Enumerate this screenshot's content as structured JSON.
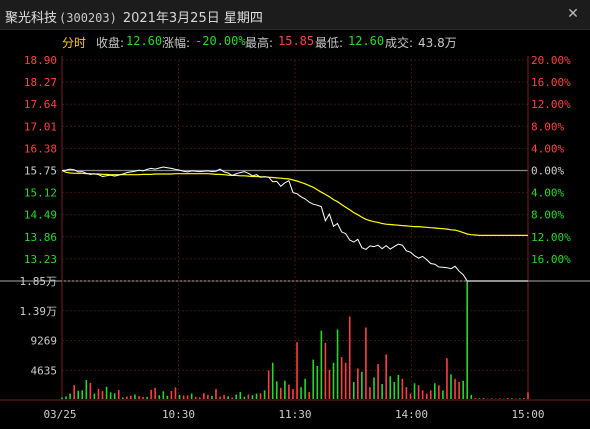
{
  "window": {
    "stock_name": "聚光科技",
    "stock_code": "(300203)",
    "date": "2021年3月25日",
    "weekday": "星期四",
    "close_icon": "close-icon"
  },
  "info_bar": {
    "tab_label": "分时",
    "close_label": "收盘:",
    "close_value": "12.60",
    "change_label": "涨幅:",
    "change_value": "-20.00%",
    "high_label": "最高:",
    "high_value": "15.85",
    "low_label": "最低:",
    "low_value": "12.60",
    "volume_label": "成交:",
    "volume_value": "43.8万"
  },
  "colors": {
    "background": "#000000",
    "price_line": "#ffffff",
    "avg_line": "#ffff00",
    "up": "#ff4040",
    "down": "#26d926",
    "grid": "#4a1a1a"
  },
  "chart_data": {
    "type": "line",
    "prev_close": 15.75,
    "y_ticks": [
      "18.90",
      "18.27",
      "17.64",
      "17.01",
      "16.38",
      "15.75",
      "15.12",
      "14.49",
      "13.86",
      "13.23"
    ],
    "pct_ticks_up": [
      "20.00%",
      "16.00%",
      "12.00%",
      "8.00%",
      "4.00%",
      "0.00%"
    ],
    "pct_ticks_down": [
      "4.00%",
      "8.00%",
      "12.00%",
      "16.00%"
    ],
    "ylim": [
      12.6,
      18.9
    ],
    "x_ticks": [
      "03/25",
      "10:30",
      "11:30",
      "14:00",
      "15:00"
    ],
    "price": [
      15.75,
      15.76,
      15.79,
      15.77,
      15.71,
      15.72,
      15.67,
      15.64,
      15.66,
      15.63,
      15.58,
      15.6,
      15.62,
      15.59,
      15.62,
      15.65,
      15.69,
      15.71,
      15.73,
      15.76,
      15.74,
      15.78,
      15.81,
      15.79,
      15.82,
      15.85,
      15.83,
      15.81,
      15.78,
      15.76,
      15.73,
      15.71,
      15.74,
      15.73,
      15.72,
      15.73,
      15.74,
      15.72,
      15.73,
      15.79,
      15.71,
      15.68,
      15.61,
      15.66,
      15.69,
      15.72,
      15.67,
      15.6,
      15.63,
      15.56,
      15.57,
      15.56,
      15.43,
      15.44,
      15.3,
      15.4,
      15.46,
      15.12,
      15.09,
      15.0,
      14.94,
      14.85,
      14.79,
      14.76,
      14.72,
      14.32,
      14.51,
      14.16,
      14.24,
      14.0,
      13.95,
      13.77,
      13.71,
      13.79,
      13.55,
      13.5,
      13.6,
      13.58,
      13.62,
      13.52,
      13.61,
      13.51,
      13.58,
      13.65,
      13.62,
      13.46,
      13.42,
      13.32,
      13.25,
      13.3,
      13.21,
      13.1,
      13.08,
      13.0,
      12.99,
      12.98,
      12.95,
      13.02,
      12.88,
      12.78,
      12.6,
      12.6,
      12.6,
      12.6,
      12.6,
      12.6,
      12.6,
      12.6,
      12.6,
      12.6,
      12.6,
      12.6,
      12.6,
      12.6,
      12.6,
      12.6
    ],
    "avg_price": [
      15.75,
      15.7,
      15.68,
      15.67,
      15.67,
      15.67,
      15.66,
      15.66,
      15.65,
      15.65,
      15.64,
      15.64,
      15.63,
      15.63,
      15.63,
      15.63,
      15.63,
      15.63,
      15.63,
      15.63,
      15.64,
      15.64,
      15.64,
      15.65,
      15.65,
      15.65,
      15.65,
      15.65,
      15.66,
      15.66,
      15.66,
      15.66,
      15.66,
      15.66,
      15.66,
      15.66,
      15.66,
      15.65,
      15.64,
      15.64,
      15.63,
      15.62,
      15.61,
      15.61,
      15.6,
      15.6,
      15.59,
      15.58,
      15.58,
      15.57,
      15.57,
      15.56,
      15.55,
      15.54,
      15.53,
      15.52,
      15.51,
      15.48,
      15.45,
      15.41,
      15.37,
      15.32,
      15.27,
      15.2,
      15.13,
      15.07,
      15.0,
      14.92,
      14.86,
      14.78,
      14.7,
      14.63,
      14.55,
      14.49,
      14.42,
      14.36,
      14.32,
      14.29,
      14.27,
      14.24,
      14.22,
      14.21,
      14.2,
      14.19,
      14.18,
      14.17,
      14.16,
      14.15,
      14.15,
      14.14,
      14.13,
      14.12,
      14.11,
      14.1,
      14.09,
      14.08,
      14.06,
      14.05,
      14.02,
      13.98,
      13.94,
      13.92,
      13.91,
      13.9,
      13.9,
      13.9,
      13.9,
      13.9,
      13.9,
      13.9,
      13.9,
      13.9,
      13.9,
      13.9,
      13.9,
      13.9
    ],
    "volume_ticks": [
      "1.85万",
      "1.39万",
      "9269",
      "4635"
    ],
    "volume_max": 18540,
    "volume": [
      {
        "v": 400,
        "u": 0
      },
      {
        "v": 550,
        "u": 0
      },
      {
        "v": 1000,
        "u": 0
      },
      {
        "v": 2300,
        "u": 1
      },
      {
        "v": 1450,
        "u": 0
      },
      {
        "v": 1500,
        "u": 0
      },
      {
        "v": 3100,
        "u": 0
      },
      {
        "v": 2650,
        "u": 1
      },
      {
        "v": 1000,
        "u": 0
      },
      {
        "v": 1750,
        "u": 1
      },
      {
        "v": 1400,
        "u": 1
      },
      {
        "v": 2050,
        "u": 0
      },
      {
        "v": 1200,
        "u": 0
      },
      {
        "v": 1050,
        "u": 0
      },
      {
        "v": 1550,
        "u": 1
      },
      {
        "v": 400,
        "u": 0
      },
      {
        "v": 550,
        "u": 1
      },
      {
        "v": 650,
        "u": 1
      },
      {
        "v": 850,
        "u": 0
      },
      {
        "v": 600,
        "u": 1
      },
      {
        "v": 450,
        "u": 1
      },
      {
        "v": 500,
        "u": 0
      },
      {
        "v": 1600,
        "u": 1
      },
      {
        "v": 1900,
        "u": 1
      },
      {
        "v": 750,
        "u": 0
      },
      {
        "v": 1350,
        "u": 0
      },
      {
        "v": 650,
        "u": 0
      },
      {
        "v": 1400,
        "u": 1
      },
      {
        "v": 1950,
        "u": 1
      },
      {
        "v": 800,
        "u": 0
      },
      {
        "v": 700,
        "u": 1
      },
      {
        "v": 700,
        "u": 1
      },
      {
        "v": 1000,
        "u": 0
      },
      {
        "v": 500,
        "u": 1
      },
      {
        "v": 400,
        "u": 1
      },
      {
        "v": 1050,
        "u": 1
      },
      {
        "v": 800,
        "u": 1
      },
      {
        "v": 650,
        "u": 0
      },
      {
        "v": 1700,
        "u": 1
      },
      {
        "v": 550,
        "u": 1
      },
      {
        "v": 800,
        "u": 1
      },
      {
        "v": 600,
        "u": 0
      },
      {
        "v": 400,
        "u": 1
      },
      {
        "v": 850,
        "u": 0
      },
      {
        "v": 1250,
        "u": 0
      },
      {
        "v": 500,
        "u": 0
      },
      {
        "v": 850,
        "u": 1
      },
      {
        "v": 750,
        "u": 0
      },
      {
        "v": 1000,
        "u": 0
      },
      {
        "v": 1050,
        "u": 1
      },
      {
        "v": 1500,
        "u": 0
      },
      {
        "v": 4600,
        "u": 1
      },
      {
        "v": 5800,
        "u": 0
      },
      {
        "v": 2900,
        "u": 0
      },
      {
        "v": 1900,
        "u": 1
      },
      {
        "v": 3000,
        "u": 0
      },
      {
        "v": 2400,
        "u": 1
      },
      {
        "v": 1700,
        "u": 1
      },
      {
        "v": 9000,
        "u": 1
      },
      {
        "v": 2000,
        "u": 0
      },
      {
        "v": 3300,
        "u": 0
      },
      {
        "v": 1250,
        "u": 1
      },
      {
        "v": 6300,
        "u": 0
      },
      {
        "v": 5300,
        "u": 0
      },
      {
        "v": 10800,
        "u": 0
      },
      {
        "v": 8900,
        "u": 1
      },
      {
        "v": 4700,
        "u": 1
      },
      {
        "v": 5800,
        "u": 0
      },
      {
        "v": 11000,
        "u": 0
      },
      {
        "v": 6700,
        "u": 1
      },
      {
        "v": 5800,
        "u": 1
      },
      {
        "v": 13000,
        "u": 1
      },
      {
        "v": 2800,
        "u": 0
      },
      {
        "v": 4900,
        "u": 1
      },
      {
        "v": 4400,
        "u": 0
      },
      {
        "v": 11300,
        "u": 1
      },
      {
        "v": 2000,
        "u": 1
      },
      {
        "v": 3500,
        "u": 0
      },
      {
        "v": 5600,
        "u": 1
      },
      {
        "v": 2500,
        "u": 0
      },
      {
        "v": 7100,
        "u": 1
      },
      {
        "v": 3700,
        "u": 0
      },
      {
        "v": 2800,
        "u": 0
      },
      {
        "v": 3900,
        "u": 0
      },
      {
        "v": 3300,
        "u": 1
      },
      {
        "v": 2000,
        "u": 1
      },
      {
        "v": 1000,
        "u": 1
      },
      {
        "v": 2600,
        "u": 0
      },
      {
        "v": 2300,
        "u": 1
      },
      {
        "v": 1500,
        "u": 1
      },
      {
        "v": 1000,
        "u": 1
      },
      {
        "v": 1500,
        "u": 1
      },
      {
        "v": 2600,
        "u": 0
      },
      {
        "v": 2300,
        "u": 1
      },
      {
        "v": 1500,
        "u": 0
      },
      {
        "v": 6500,
        "u": 1
      },
      {
        "v": 4000,
        "u": 0
      },
      {
        "v": 3300,
        "u": 1
      },
      {
        "v": 2800,
        "u": 1
      },
      {
        "v": 3000,
        "u": 0
      },
      {
        "v": 18540,
        "u": 0
      },
      {
        "v": 800,
        "u": 0
      },
      {
        "v": 300,
        "u": 1
      },
      {
        "v": 250,
        "u": 0
      },
      {
        "v": 300,
        "u": 1
      },
      {
        "v": 200,
        "u": 0
      },
      {
        "v": 250,
        "u": 1
      },
      {
        "v": 200,
        "u": 0
      },
      {
        "v": 250,
        "u": 1
      },
      {
        "v": 200,
        "u": 0
      },
      {
        "v": 300,
        "u": 1
      },
      {
        "v": 250,
        "u": 0
      },
      {
        "v": 200,
        "u": 1
      },
      {
        "v": 250,
        "u": 0
      },
      {
        "v": 300,
        "u": 1
      },
      {
        "v": 1200,
        "u": 1
      }
    ]
  }
}
